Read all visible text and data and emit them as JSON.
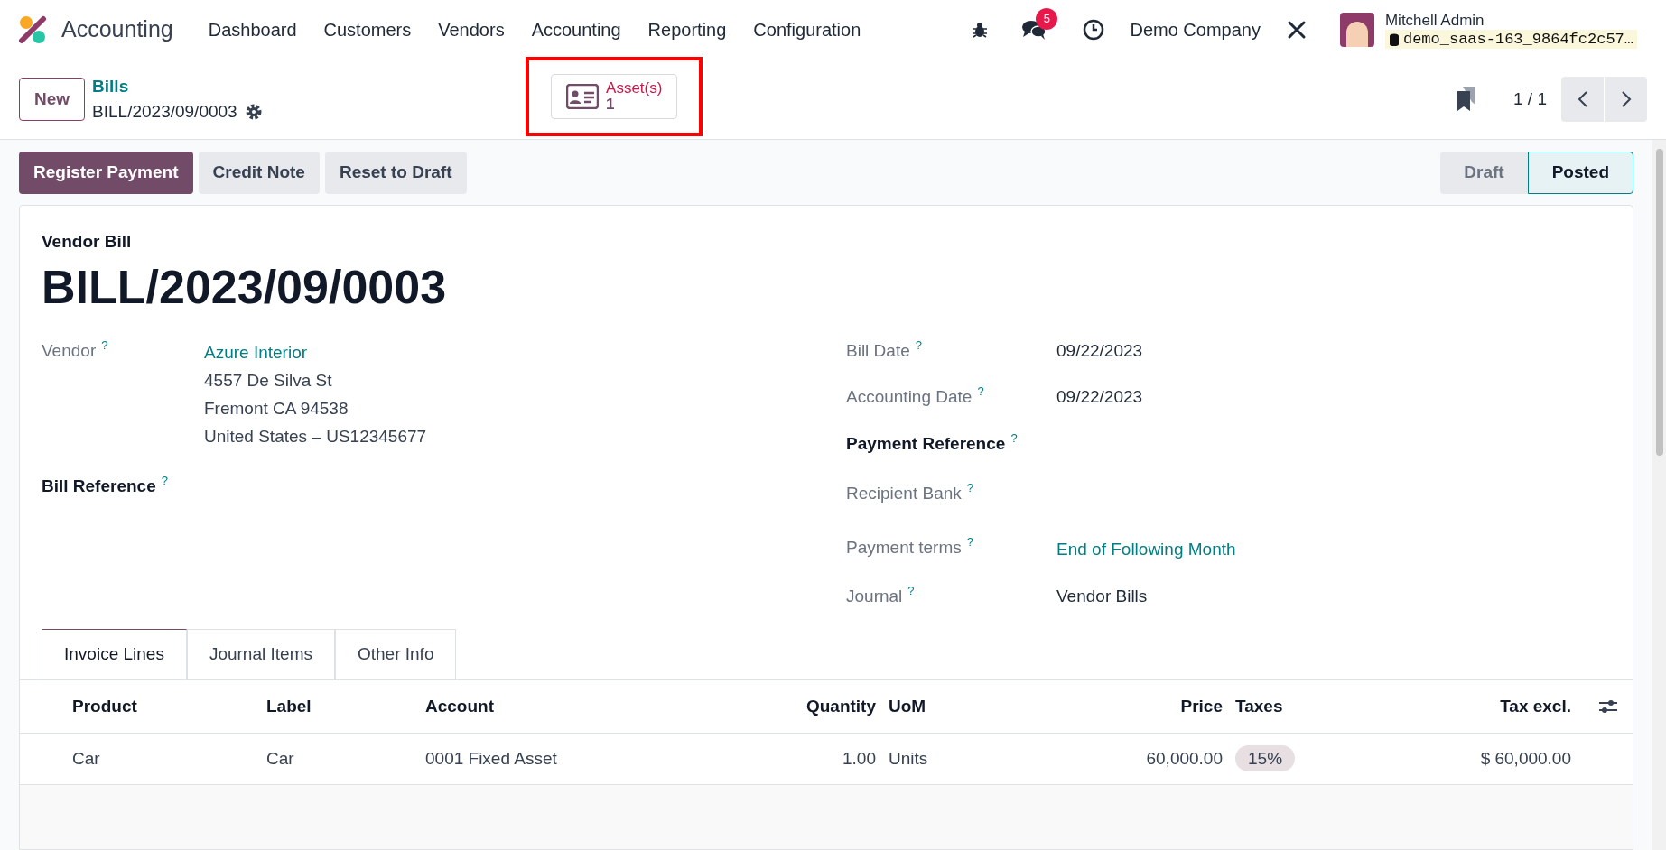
{
  "navbar": {
    "app_name": "Accounting",
    "menu": [
      "Dashboard",
      "Customers",
      "Vendors",
      "Accounting",
      "Reporting",
      "Configuration"
    ],
    "message_count": "5",
    "company": "Demo Company",
    "user": {
      "name": "Mitchell Admin",
      "database": "demo_saas-163_9864fc2c57…"
    }
  },
  "control_panel": {
    "new_button": "New",
    "breadcrumb": "Bills",
    "record": "BILL/2023/09/0003",
    "smart_button": {
      "label": "Asset(s)",
      "count": "1",
      "highlighted": true
    },
    "pager": "1 / 1"
  },
  "actions": [
    {
      "label": "Register Payment",
      "kind": "primary"
    },
    {
      "label": "Credit Note",
      "kind": "secondary"
    },
    {
      "label": "Reset to Draft",
      "kind": "secondary"
    }
  ],
  "status_bar": [
    {
      "label": "Draft",
      "selected": false
    },
    {
      "label": "Posted",
      "selected": true
    }
  ],
  "form": {
    "type_label": "Vendor Bill",
    "name": "BILL/2023/09/0003",
    "left_fields": [
      {
        "label": "Vendor",
        "bold": false,
        "link": "Azure Interior",
        "lines": [
          "4557 De Silva St",
          "Fremont CA 94538",
          "United States – US12345677"
        ]
      },
      {
        "label": "Bill Reference",
        "bold": true
      }
    ],
    "right_fields": [
      {
        "label": "Bill Date",
        "bold": false,
        "value": "09/22/2023"
      },
      {
        "label": "Accounting Date",
        "bold": false,
        "value": "09/22/2023"
      },
      {
        "label": "Payment Reference",
        "bold": true
      },
      {
        "label": "Recipient Bank",
        "bold": false
      },
      {
        "label": "Payment terms",
        "bold": false,
        "link": "End of Following Month"
      },
      {
        "label": "Journal",
        "bold": false,
        "value": "Vendor Bills"
      }
    ],
    "help_mark": "?"
  },
  "tabs": [
    {
      "label": "Invoice Lines",
      "selected": true
    },
    {
      "label": "Journal Items",
      "selected": false
    },
    {
      "label": "Other Info",
      "selected": false
    }
  ],
  "table": {
    "columns": [
      "Product",
      "Label",
      "Account",
      "Quantity",
      "UoM",
      "Price",
      "Taxes",
      "Tax excl."
    ],
    "rows": [
      {
        "cells": [
          "Car",
          "Car",
          "0001 Fixed Asset",
          "1.00",
          "Units",
          "60,000.00",
          "15%",
          "$ 60,000.00"
        ]
      }
    ]
  }
}
